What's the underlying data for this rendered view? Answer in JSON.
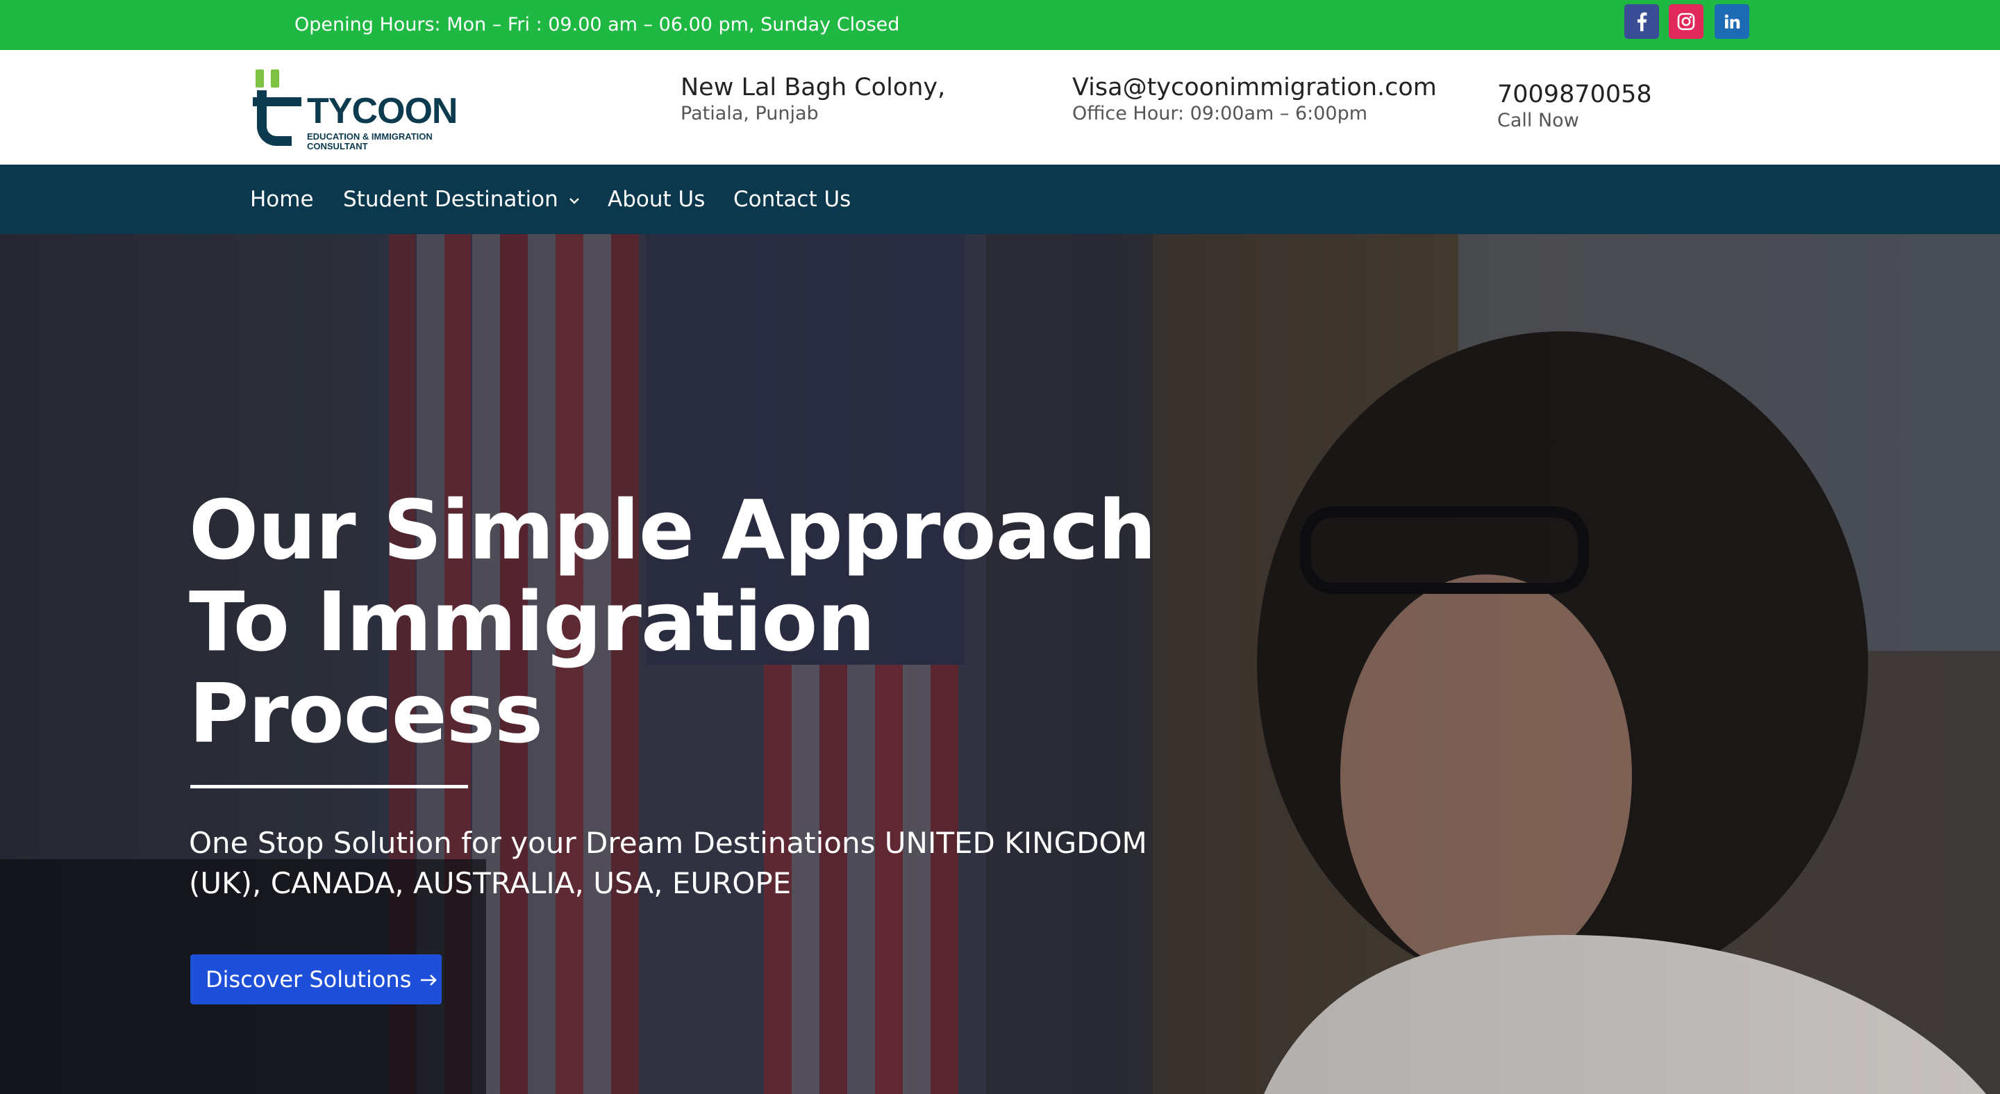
{
  "topbar": {
    "hours": "Opening Hours: Mon – Fri : 09.00 am – 06.00 pm, Sunday Closed",
    "social": [
      "facebook-icon",
      "instagram-icon",
      "linkedin-icon"
    ],
    "colors": {
      "bar": "#1fb843",
      "facebook": "#3b4d94",
      "instagram": "#e0285b",
      "linkedin": "#1c6bb4"
    }
  },
  "header": {
    "logo": {
      "word": "TYCOON",
      "sub": "EDUCATION & IMMIGRATION CONSULTANT"
    },
    "address": {
      "line1": "New Lal Bagh Colony,",
      "line2": "Patiala, Punjab"
    },
    "email": {
      "address": "Visa@tycoonimmigration.com",
      "hours": "Office Hour: 09:00am – 6:00pm"
    },
    "phone": {
      "number": "7009870058",
      "label": "Call Now"
    }
  },
  "nav": {
    "items": [
      {
        "label": "Home"
      },
      {
        "label": "Student Destination",
        "has_dropdown": true
      },
      {
        "label": "About Us"
      },
      {
        "label": "Contact Us"
      }
    ],
    "color": "#0b384d"
  },
  "hero": {
    "headline": "Our Simple Approach To Immigration Process",
    "subtext": "One Stop Solution for your Dream Destinations UNITED KINGDOM (UK), CANADA, AUSTRALIA, USA, EUROPE",
    "cta_label": "Discover Solutions",
    "cta_icon": "arrow-right-icon",
    "cta_color": "#1d4fd8"
  }
}
